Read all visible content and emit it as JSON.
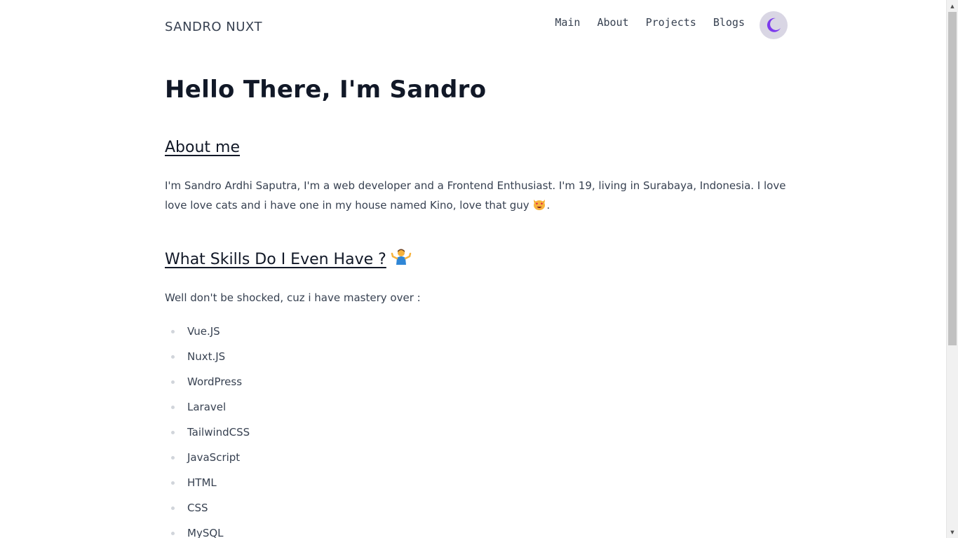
{
  "header": {
    "brand": "SANDRO NUXT",
    "nav": [
      {
        "label": "Main"
      },
      {
        "label": "About"
      },
      {
        "label": "Projects"
      },
      {
        "label": "Blogs"
      }
    ],
    "theme_toggle_icon": "moon-icon"
  },
  "main": {
    "title": "Hello There, I'm Sandro",
    "about": {
      "heading": "About me",
      "text": "I'm Sandro Ardhi Saputra, I'm a web developer and a Frontend Enthusiast. I'm 19, living in Surabaya, Indonesia. I love love love cats and i have one in my house named Kino, love that guy",
      "text_end": ".",
      "emoji_icon": "heart-eyes-cat-icon"
    },
    "skills": {
      "heading": "What Skills Do I Even Have ?",
      "emoji_icon": "person-shrugging-icon",
      "intro": "Well don't be shocked, cuz i have mastery over :",
      "items": [
        "Vue.JS",
        "Nuxt.JS",
        "WordPress",
        "Laravel",
        "TailwindCSS",
        "JavaScript",
        "HTML",
        "CSS",
        "MySQL"
      ]
    }
  },
  "colors": {
    "heading": "#111827",
    "text": "#374151",
    "toggle_bg": "#d9d6e4",
    "moon": "#7c3aed"
  }
}
